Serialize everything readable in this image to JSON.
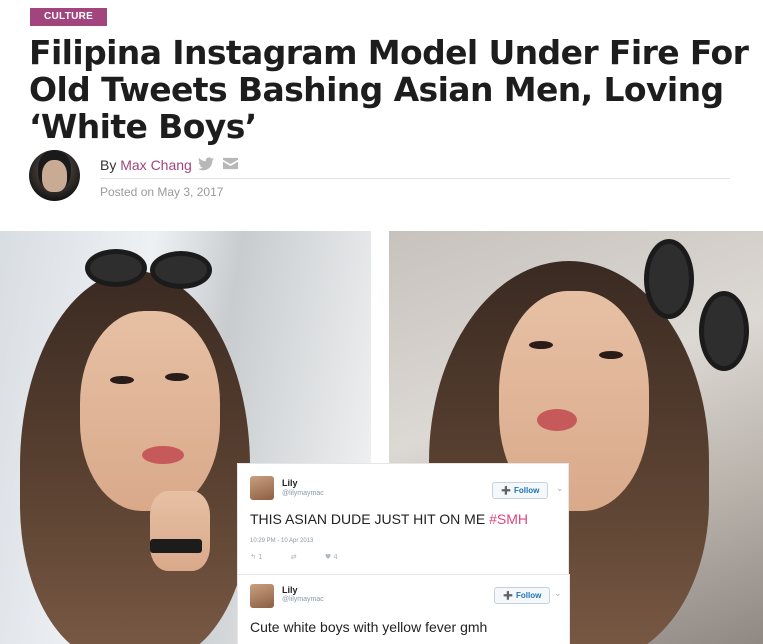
{
  "article": {
    "category": "CULTURE",
    "headline": "Filipina Instagram Model Under Fire For Old Tweets Bashing Asian Men, Loving ‘White Boys’",
    "byline_prefix": "By",
    "author": "Max Chang",
    "posted": "Posted on May 3, 2017"
  },
  "share_icons": [
    "twitter-icon",
    "email-icon"
  ],
  "colors": {
    "accent": "#a2457e",
    "hashtag": "#e0457b",
    "twitter_blue": "#1d72b8"
  },
  "tweets": [
    {
      "name": "Lily",
      "handle": "@lilymaymac",
      "follow_label": "Follow",
      "text": "THIS ASIAN DUDE JUST HIT ON ME ",
      "hashtag": "#SMH",
      "time": "10:29 PM - 10 Apr 2013",
      "reply_count": "1",
      "like_count": "4"
    },
    {
      "name": "Lily",
      "handle": "@lilymaymac",
      "follow_label": "Follow",
      "text": "Cute white boys with yellow fever gmh"
    }
  ]
}
